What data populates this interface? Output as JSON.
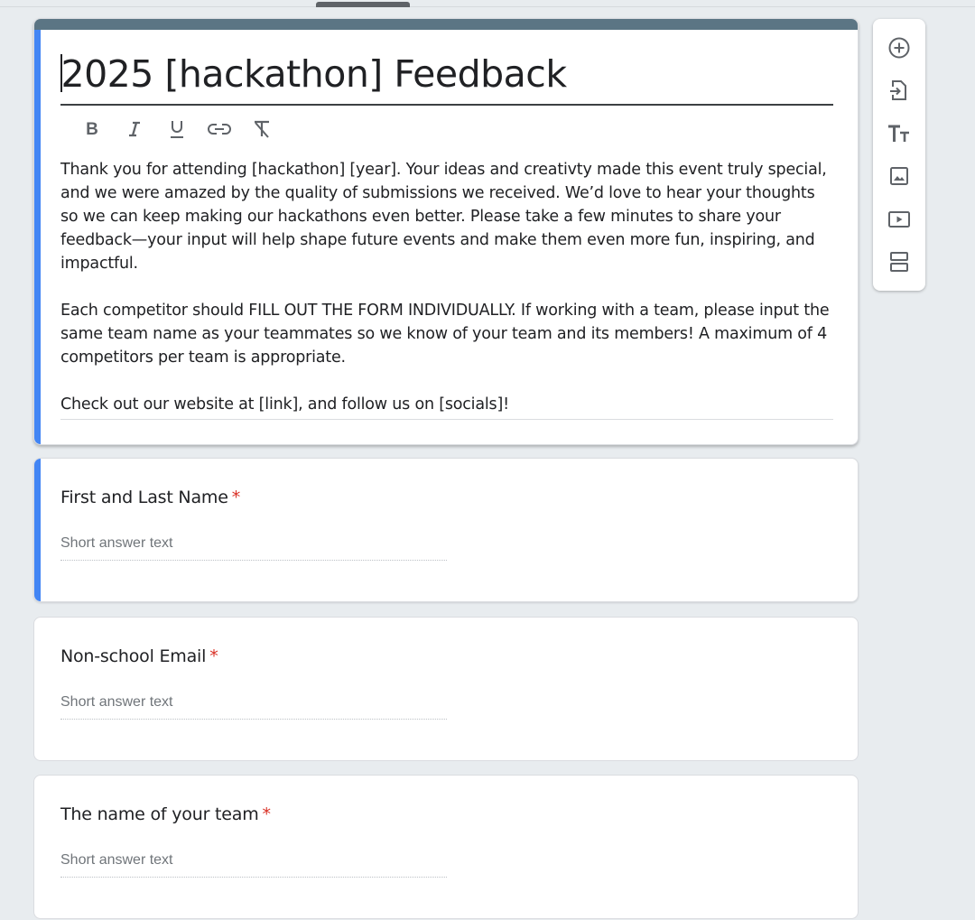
{
  "form": {
    "title": "2025 [hackathon] Feedback",
    "description": [
      "Thank you for attending [hackathon] [year]. Your ideas and creativty made this event truly special, and we were amazed by the quality of submissions we received. We’d love to hear your thoughts so we can keep making our hackathons even better. Please take a few minutes to share your feedback—your input will help shape future events and make them even more fun, inspiring, and impactful.",
      "Each competitor should FILL OUT THE FORM INDIVIDUALLY. If working with a team, please input the same team name as your teammates so we know of your team and its members! A maximum of 4 competitors per team is appropriate.",
      "Check out our website at [link], and follow us on [socials]!"
    ]
  },
  "toolbar": {
    "items": [
      "bold-icon",
      "italic-icon",
      "underline-icon",
      "link-icon",
      "clear-format-icon"
    ]
  },
  "questions": [
    {
      "title": "First and Last Name",
      "required_mark": "*",
      "answer_placeholder": "Short answer text"
    },
    {
      "title": "Non-school Email",
      "required_mark": "*",
      "answer_placeholder": "Short answer text"
    },
    {
      "title": "The name of your team",
      "required_mark": "*",
      "answer_placeholder": "Short answer text"
    }
  ],
  "sidebar": {
    "items": [
      "add-question-icon",
      "import-questions-icon",
      "add-title-icon",
      "add-image-icon",
      "add-video-icon",
      "add-section-icon"
    ]
  },
  "colors": {
    "theme_bar": "#5b7584",
    "active_accent": "#4285f4",
    "required": "#d93025",
    "background": "#e8ecef"
  }
}
